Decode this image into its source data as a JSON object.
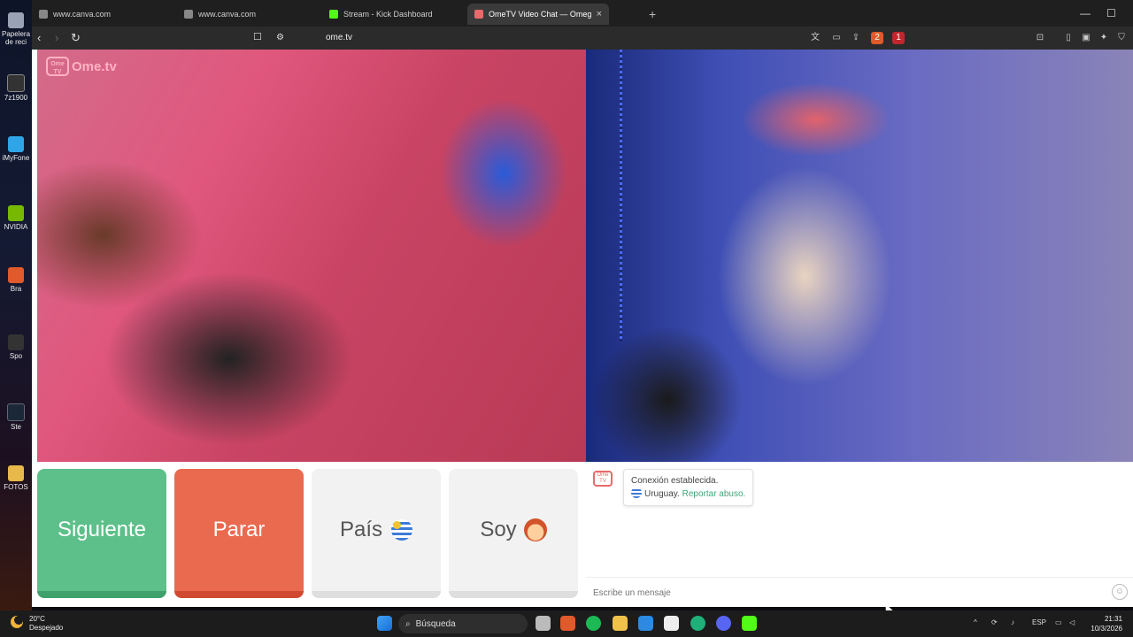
{
  "desktop": {
    "icons": [
      {
        "label": "Papelera de reci"
      },
      {
        "label": "7z1900"
      },
      {
        "label": "iMyFone"
      },
      {
        "label": "NVIDIA"
      },
      {
        "label": "Bra"
      },
      {
        "label": "Spo"
      },
      {
        "label": "Ste"
      },
      {
        "label": "FOTOS"
      }
    ]
  },
  "browser": {
    "tabs": [
      {
        "label": "www.canva.com"
      },
      {
        "label": "www.canva.com"
      },
      {
        "label": "Stream - Kick Dashboard"
      },
      {
        "label": "OmeTV Video Chat — Omeg"
      }
    ],
    "tab_close": "×",
    "new_tab": "+",
    "url": "ome.tv",
    "brave_shields_count": "2",
    "rewards_count": "1"
  },
  "page": {
    "logo_text": "Ome.tv",
    "logo_badge": "Ome TV",
    "buttons": {
      "next": "Siguiente",
      "stop": "Parar",
      "country": "País",
      "gender": "Soy"
    },
    "chat": {
      "system_line1": "Conexión establecida.",
      "system_country": "Uruguay.",
      "report_link": "Reportar abuso.",
      "input_placeholder": "Escribe un mensaje"
    }
  },
  "taskbar": {
    "temperature": "20°C",
    "weather": "Despejado",
    "search_label": "Búsqueda",
    "language": "ESP",
    "time": "21:31",
    "date": "10/3/2026"
  }
}
